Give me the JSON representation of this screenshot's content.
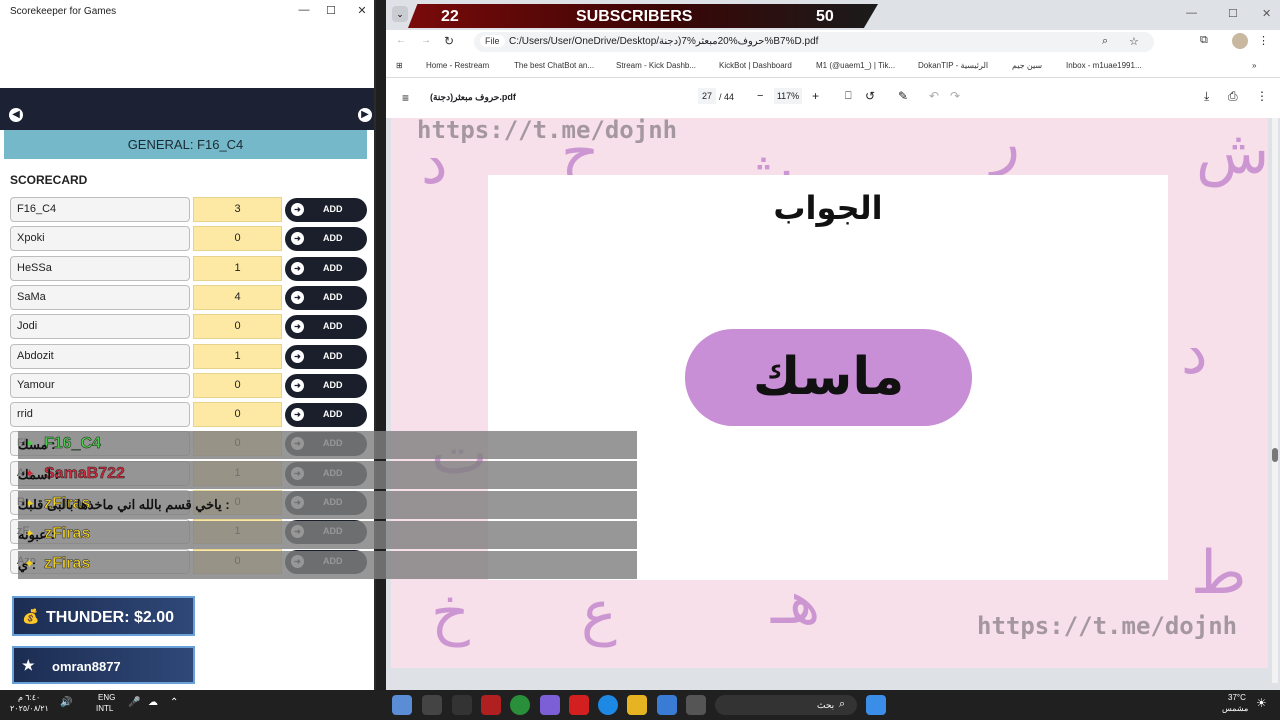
{
  "scorekeeper": {
    "window_title": "Scorekeeper for Games",
    "general_label": "GENERAL: F16_C4",
    "scorecard_title": "SCORECARD",
    "add_label": "ADD",
    "players": [
      {
        "name": "F16_C4",
        "score": "3"
      },
      {
        "name": "Xpoki",
        "score": "0"
      },
      {
        "name": "HeSSa",
        "score": "1"
      },
      {
        "name": "SaMa",
        "score": "4"
      },
      {
        "name": "Jodi",
        "score": "0"
      },
      {
        "name": "Abdozit",
        "score": "1"
      },
      {
        "name": "Yamour",
        "score": "0"
      },
      {
        "name": "rrid",
        "score": "0"
      },
      {
        "name": "Fl",
        "score": "0"
      },
      {
        "name": "A",
        "score": "1"
      },
      {
        "name": "R",
        "score": "0"
      },
      {
        "name": "zF",
        "score": "1"
      },
      {
        "name": "Azo",
        "score": "0"
      }
    ]
  },
  "chat": [
    {
      "user": "F16_C4",
      "message": "مسك :",
      "color": "#4ecb4e"
    },
    {
      "user": "SamaB722",
      "message": "اسمك :",
      "color": "#d22a3c"
    },
    {
      "user": "zFiras",
      "message": "ياخي قسم بالله اني ماخذها بالبى قلبك :",
      "color": "#f0d021"
    },
    {
      "user": "zFiras",
      "message": "عبونه :",
      "color": "#f0d021"
    },
    {
      "user": "zFiras",
      "message": "ي :",
      "color": "#f0d021"
    }
  ],
  "alerts": {
    "thunder": "THUNDER: $2.00",
    "follower": "omran8877"
  },
  "stream_banner": {
    "left_number": "22",
    "label": "SUBSCRIBERS",
    "right_number": "50"
  },
  "browser": {
    "file_chip": "File",
    "url": "C:/Users/User/OneDrive/Desktop/حروف%20مبعثر%7(دجنة%B7%D.pdf",
    "bookmarks": [
      "Home - Restream",
      "The best ChatBot an...",
      "Stream - Kick Dashb...",
      "KickBot | Dashboard",
      "M1 (@uaem1_) | Tik...",
      "DokanTIP - الرئيسية",
      "سين جيم",
      "Inbox - m1uae1991..."
    ],
    "pdf_name": "حروف مبعثر(دجنة).pdf",
    "page_current": "27",
    "page_total": "/ 44",
    "zoom": "117%"
  },
  "pdf": {
    "heading": "الجواب",
    "answer": "ماسك",
    "watermark": "https://t.me/dojnh"
  },
  "taskbar": {
    "time": "٦:٤٠ م",
    "date": "٢٠٢٥/٠٨/٢١",
    "lang_top": "ENG",
    "lang_bottom": "INTL",
    "search_label": "بحث",
    "temp": "37°C",
    "weather": "مشمس"
  }
}
